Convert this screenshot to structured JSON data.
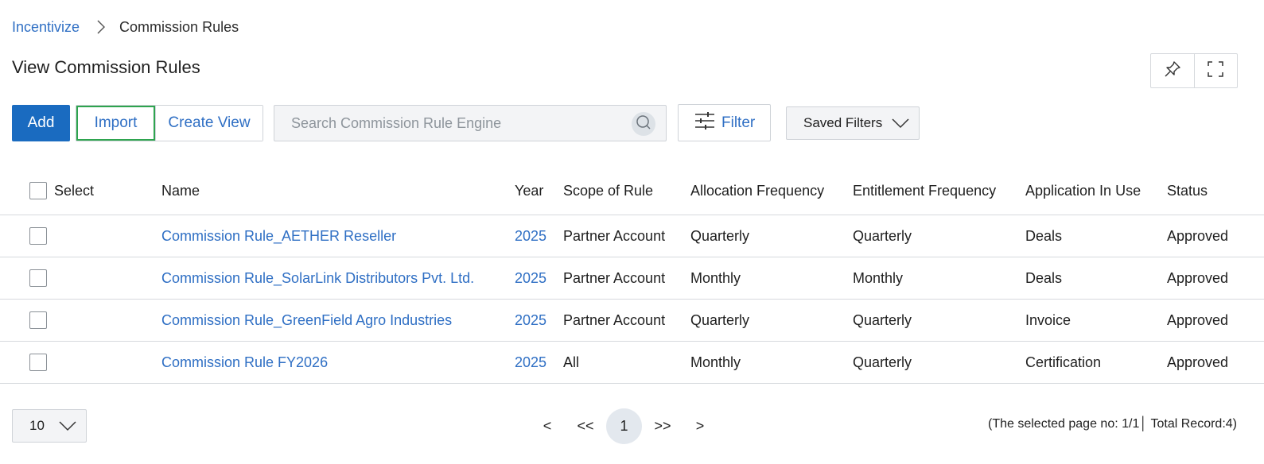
{
  "breadcrumb": {
    "root": "Incentivize",
    "current": "Commission Rules"
  },
  "page_title": "View Commission Rules",
  "toolbar": {
    "add_label": "Add",
    "import_label": "Import",
    "create_view_label": "Create View",
    "search_placeholder": "Search Commission Rule Engine",
    "filter_label": "Filter",
    "saved_filters_label": "Saved Filters"
  },
  "table": {
    "headers": {
      "select": "Select",
      "name": "Name",
      "year": "Year",
      "scope": "Scope of Rule",
      "allocation": "Allocation Frequency",
      "entitlement": "Entitlement Frequency",
      "application": "Application In Use",
      "status": "Status"
    },
    "rows": [
      {
        "name": "Commission Rule_AETHER Reseller",
        "year": "2025",
        "scope": "Partner Account",
        "allocation": "Quarterly",
        "entitlement": "Quarterly",
        "application": "Deals",
        "status": "Approved"
      },
      {
        "name": "Commission Rule_SolarLink Distributors Pvt. Ltd.",
        "year": "2025",
        "scope": "Partner Account",
        "allocation": "Monthly",
        "entitlement": "Monthly",
        "application": "Deals",
        "status": "Approved"
      },
      {
        "name": "Commission Rule_GreenField Agro Industries",
        "year": "2025",
        "scope": "Partner Account",
        "allocation": "Quarterly",
        "entitlement": "Quarterly",
        "application": "Invoice",
        "status": "Approved"
      },
      {
        "name": "Commission Rule FY2026",
        "year": "2025",
        "scope": "All",
        "allocation": "Monthly",
        "entitlement": "Quarterly",
        "application": "Certification",
        "status": "Approved"
      }
    ]
  },
  "pagination": {
    "page_size": "10",
    "prev": "<",
    "first": "<<",
    "current_page": "1",
    "last": ">>",
    "next": ">",
    "record_info": "(The selected page no: 1/1│ Total Record:4)"
  },
  "colors": {
    "primary": "#1a6bc0",
    "link": "#2f6fc4",
    "highlight_border": "#2ea44f"
  }
}
